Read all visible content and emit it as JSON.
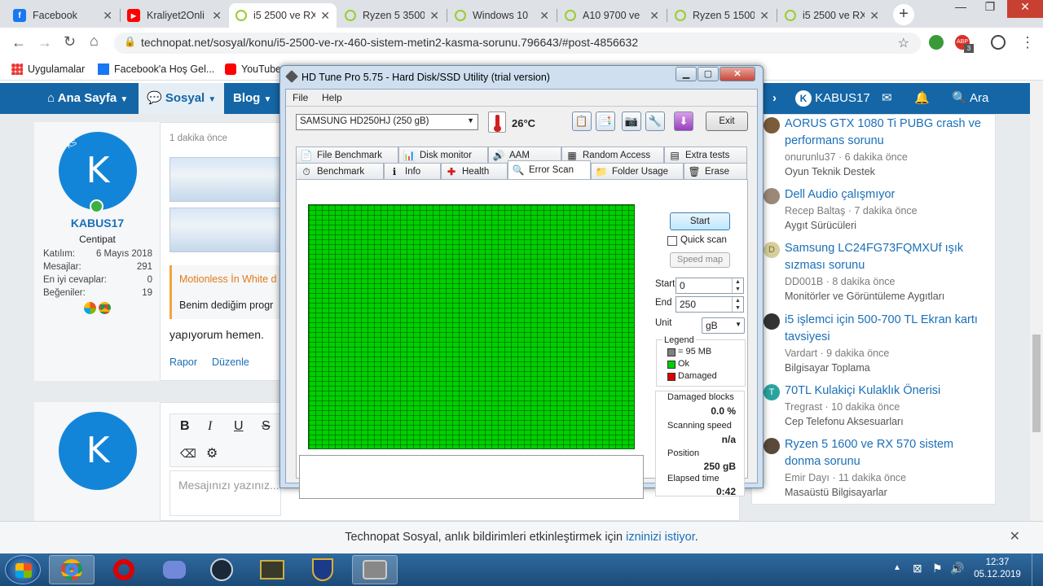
{
  "tabs": [
    {
      "title": "Facebook",
      "icon": "facebook-icon",
      "color": "#1877f2"
    },
    {
      "title": "Kraliyet2Onli",
      "icon": "youtube-icon",
      "color": "#ff0000"
    },
    {
      "title": "i5 2500 ve RX",
      "icon": "technopat-icon",
      "color": "#9acd32"
    },
    {
      "title": "Ryzen 5 3500",
      "icon": "technopat-icon",
      "color": "#9acd32"
    },
    {
      "title": "Windows 10",
      "icon": "technopat-icon",
      "color": "#9acd32"
    },
    {
      "title": "A10 9700 ve",
      "icon": "technopat-icon",
      "color": "#9acd32"
    },
    {
      "title": "Ryzen 5 1500",
      "icon": "technopat-icon",
      "color": "#9acd32"
    },
    {
      "title": "i5 2500 ve RX",
      "icon": "technopat-icon",
      "color": "#9acd32"
    }
  ],
  "address": {
    "url": "technopat.net/sosyal/konu/i5-2500-ve-rx-460-sistem-metin2-kasma-sorunu.796643/#post-4856632"
  },
  "bookmarks": [
    "Uygulamalar",
    "Facebook'a Hoş Gel...",
    "YouTube"
  ],
  "extension_badge": "3",
  "nav": {
    "home": "Ana Sayfa",
    "social": "Sosyal",
    "blog": "Blog",
    "user": "KABUS17",
    "search": "Ara"
  },
  "post": {
    "avatar_letter": "K",
    "avatar_tag": "KS",
    "username": "KABUS17",
    "rank": "Centipat",
    "stats": [
      {
        "k": "Katılım:",
        "v": "6 Mayıs 2018"
      },
      {
        "k": "Mesajlar:",
        "v": "291"
      },
      {
        "k": "En iyi cevaplar:",
        "v": "0"
      },
      {
        "k": "Beğeniler:",
        "v": "19"
      }
    ],
    "time": "1 dakika önce",
    "quote_author": "Motionless İn White d",
    "quote_text": "Benim dediğim progr",
    "body": "yapıyorum hemen.",
    "report": "Rapor",
    "edit": "Düzenle"
  },
  "reply": {
    "avatar_letter": "K",
    "placeholder": "Mesajınızı yazınız..."
  },
  "sidebar": [
    {
      "title": "AORUS GTX 1080 Ti PUBG crash ve performans sorunu",
      "meta": "onurunlu37 · 6 dakika önce",
      "forum": "Oyun Teknik Destek",
      "avcolor": "#7a5c3a",
      "avletter": ""
    },
    {
      "title": "Dell Audio çalışmıyor",
      "meta": "Recep Baltaş · 7 dakika önce",
      "forum": "Aygıt Sürücüleri",
      "avcolor": "#9a8878",
      "avletter": ""
    },
    {
      "title": "Samsung LC24FG73FQMXUf ışık sızması sorunu",
      "meta": "DD001B · 8 dakika önce",
      "forum": "Monitörler ve Görüntüleme Aygıtları",
      "avcolor": "#d6cf9c",
      "avletter": "D"
    },
    {
      "title": "i5 işlemci için 500-700 TL Ekran kartı tavsiyesi",
      "meta": "Vardart · 9 dakika önce",
      "forum": "Bilgisayar Toplama",
      "avcolor": "#333333",
      "avletter": ""
    },
    {
      "title": "70TL Kulakiçi Kulaklık Önerisi",
      "meta": "Tregrast · 10 dakika önce",
      "forum": "Cep Telefonu Aksesuarları",
      "avcolor": "#2aa3a0",
      "avletter": "T"
    },
    {
      "title": "Ryzen 5 1600 ve RX 570 sistem donma sorunu",
      "meta": "Emir Dayı · 11 dakika önce",
      "forum": "Masaüstü Bilgisayarlar",
      "avcolor": "#5a4a3a",
      "avletter": ""
    }
  ],
  "notification": {
    "text": "Technopat Sosyal, anlık bildirimleri etkinleştirmek için ",
    "link": "izninizi istiyor",
    "end": "."
  },
  "hdtune": {
    "title": "HD Tune Pro 5.75 - Hard Disk/SSD Utility (trial version)",
    "menu": [
      "File",
      "Help"
    ],
    "drive": "SAMSUNG HD250HJ (250 gB)",
    "temp": "26°C",
    "exit": "Exit",
    "tabs_row1": [
      "File Benchmark",
      "Disk monitor",
      "AAM",
      "Random Access",
      "Extra tests"
    ],
    "tabs_row2": [
      "Benchmark",
      "Info",
      "Health",
      "Error Scan",
      "Folder Usage",
      "Erase"
    ],
    "start_btn": "Start",
    "quick_scan": "Quick scan",
    "speed_map": "Speed map",
    "start_label": "Start",
    "start_val": "0",
    "end_label": "End",
    "end_val": "250",
    "unit_label": "Unit",
    "unit_val": "gB",
    "legend_title": "Legend",
    "legend": [
      "= 95 MB",
      "Ok",
      "Damaged"
    ],
    "legend_colors": [
      "#808080",
      "#00d000",
      "#e00000"
    ],
    "damaged_label": "Damaged blocks",
    "damaged_val": "0.0 %",
    "speed_label": "Scanning speed",
    "speed_val": "n/a",
    "pos_label": "Position",
    "pos_val": "250 gB",
    "elapsed_label": "Elapsed time",
    "elapsed_val": "0:42"
  },
  "clock": {
    "time": "12:37",
    "date": "05.12.2019"
  }
}
